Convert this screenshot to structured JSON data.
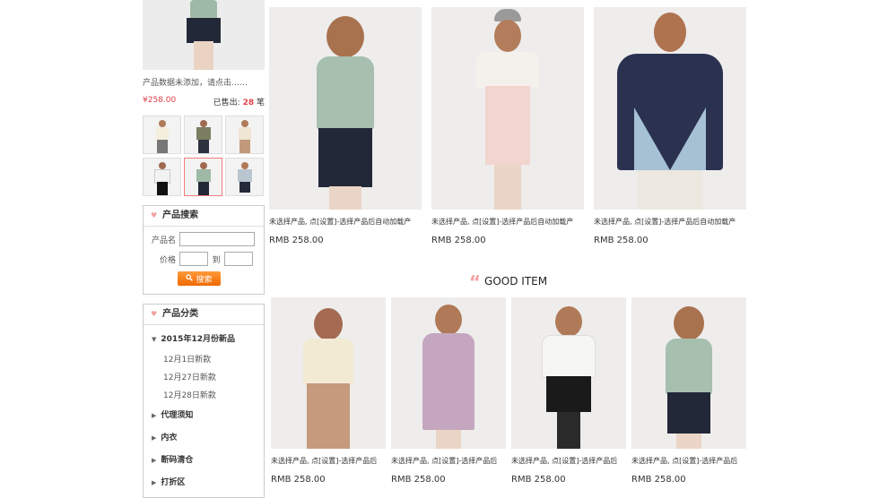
{
  "sidebar": {
    "featured": {
      "description": "产品数据未添加，请点击……",
      "price": "¥258.00",
      "sold_prefix": "已售出:",
      "sold_count": "28",
      "sold_suffix": "笔"
    },
    "search": {
      "title": "产品搜索",
      "name_label": "产品名",
      "price_label": "价格",
      "to_label": "到",
      "button": "搜索"
    },
    "categories": {
      "title": "产品分类",
      "items": [
        {
          "label": "2015年12月份新品"
        },
        {
          "label": "12月1日新款"
        },
        {
          "label": "12月27日新款"
        },
        {
          "label": "12月28日新款"
        },
        {
          "label": "代理须知"
        },
        {
          "label": "内衣"
        },
        {
          "label": "断码清仓"
        },
        {
          "label": "打折区"
        }
      ]
    }
  },
  "main": {
    "row1": [
      {
        "name": "未选择产品, 点[设置]-选择产品后自动加载产",
        "price": "RMB 258.00"
      },
      {
        "name": "未选择产品, 点[设置]-选择产品后自动加载产",
        "price": "RMB 258.00"
      },
      {
        "name": "未选择产品, 点[设置]-选择产品后自动加载产",
        "price": "RMB 258.00"
      }
    ],
    "section_title": "GOOD ITEM",
    "row2": [
      {
        "name": "未选择产品, 点[设置]-选择产品后",
        "price": "RMB 258.00"
      },
      {
        "name": "未选择产品, 点[设置]-选择产品后",
        "price": "RMB 258.00"
      },
      {
        "name": "未选择产品, 点[设置]-选择产品后",
        "price": "RMB 258.00"
      },
      {
        "name": "未选择产品, 点[设置]-选择产品后",
        "price": "RMB 258.00"
      }
    ]
  },
  "colors": {
    "accent_red": "#e2404b",
    "accent_pink": "#f4a1a1",
    "search_orange": "#f06800"
  }
}
